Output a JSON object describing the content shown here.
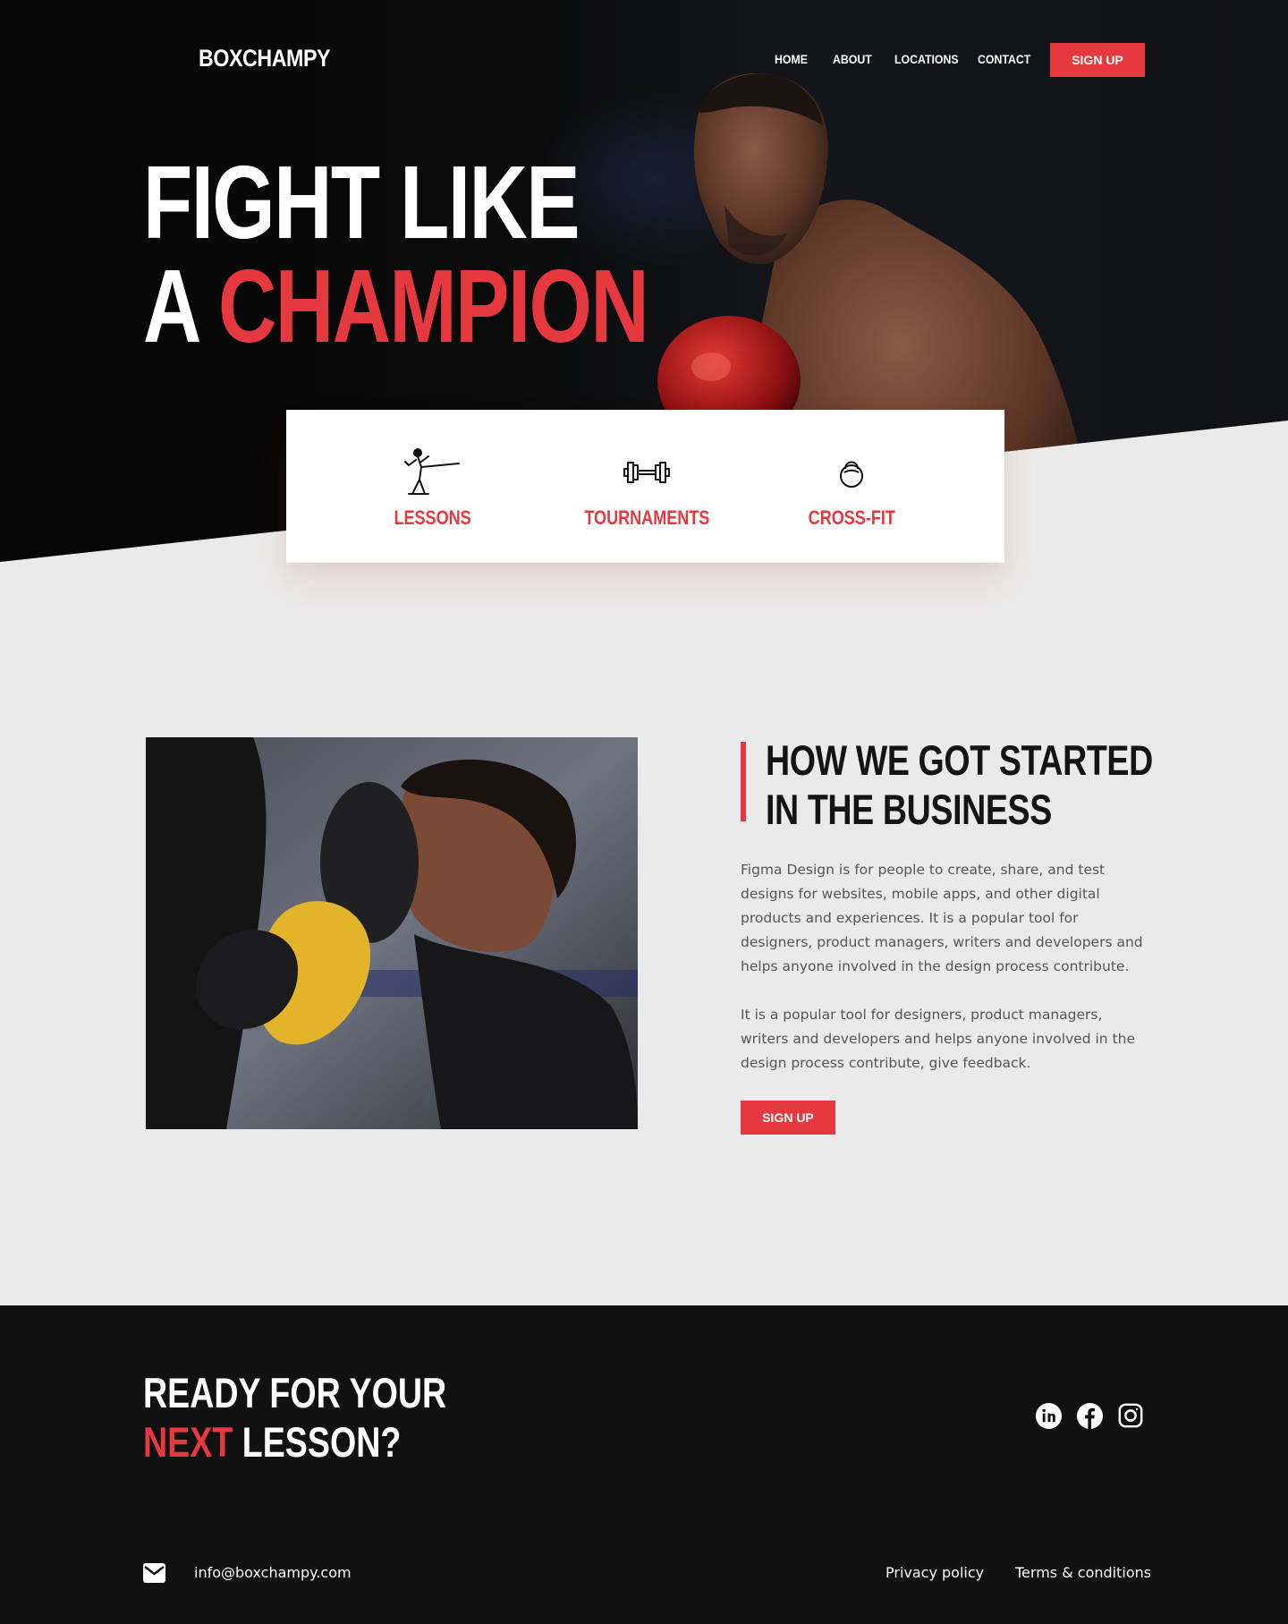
{
  "brand": "BOXCHAMPY",
  "nav": {
    "items": [
      "HOME",
      "ABOUT",
      "LOCATIONS",
      "CONTACT"
    ],
    "signup_label": "SIGN UP"
  },
  "hero": {
    "line1": "FIGHT LIKE",
    "line2_prefix": "A",
    "line2_accent": "CHAMPION"
  },
  "services": [
    {
      "label": "LESSONS",
      "icon": "kicking-fighter-icon"
    },
    {
      "label": "TOURNAMENTS",
      "icon": "dumbbell-icon"
    },
    {
      "label": "CROSS-FIT",
      "icon": "kettlebell-icon"
    }
  ],
  "about": {
    "title_line1": "HOW WE GOT STARTED",
    "title_line2": "IN THE BUSINESS",
    "paragraph1": "Figma Design is for people to create, share, and test designs for websites, mobile apps, and other digital products and experiences. It  is a popular tool for designers, product managers, writers and developers and helps anyone involved in the design process contribute.",
    "paragraph2": "It is a popular tool for designers, product managers, writers and developers and helps anyone involved in the design process contribute, give feedback.",
    "signup_label": "SIGN UP"
  },
  "footer": {
    "cta_line1": "READY FOR YOUR",
    "cta_accent": "NEXT",
    "cta_rest": "LESSON?",
    "social": [
      "linkedin-icon",
      "facebook-icon",
      "instagram-icon"
    ],
    "email": "info@boxchampy.com",
    "links": [
      "Privacy policy",
      "Terms & conditions"
    ]
  },
  "colors": {
    "accent": "#e5393f",
    "dark": "#111111",
    "light_bg": "#ebeaea"
  }
}
